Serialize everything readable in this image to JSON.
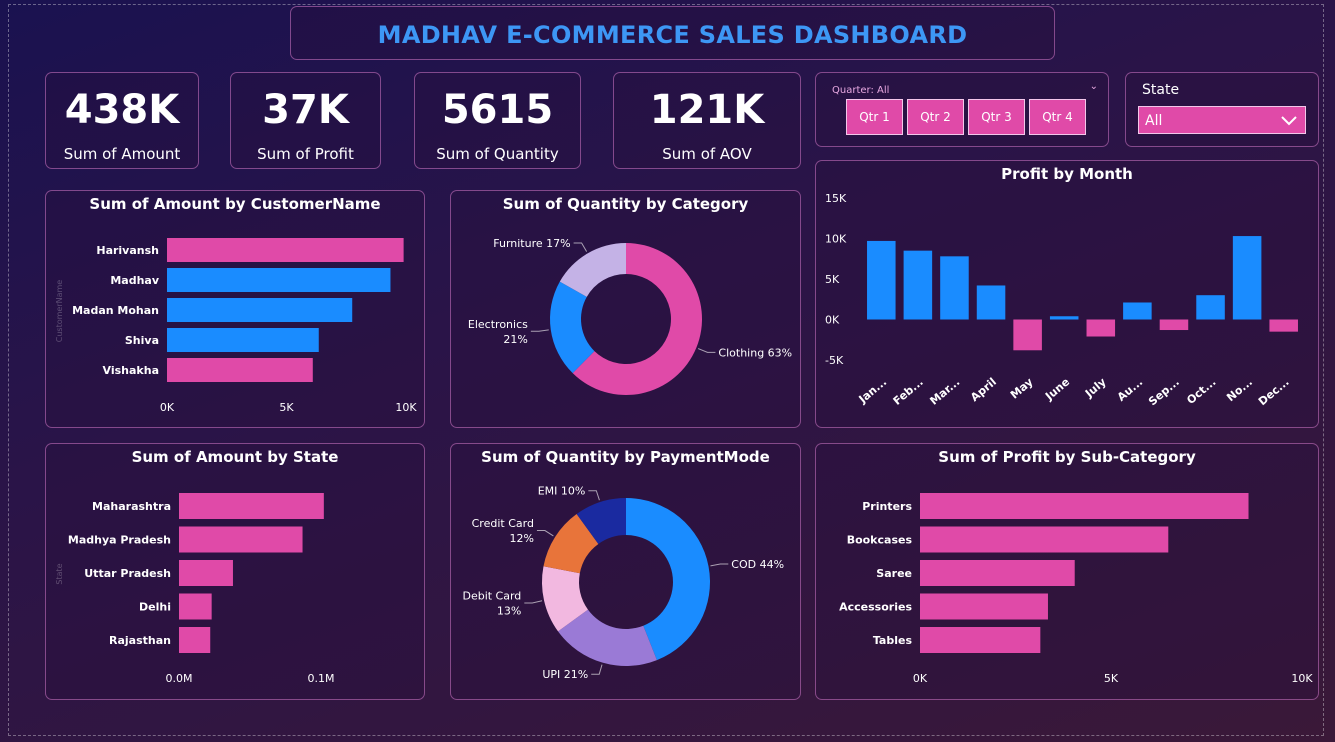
{
  "title": "MADHAV E-COMMERCE SALES DASHBOARD",
  "kpis": [
    {
      "value": "438K",
      "label": "Sum of Amount"
    },
    {
      "value": "37K",
      "label": "Sum of Profit"
    },
    {
      "value": "5615",
      "label": "Sum of Quantity"
    },
    {
      "value": "121K",
      "label": "Sum of AOV"
    }
  ],
  "quarter_slicer": {
    "title": "Quarter: All",
    "options": [
      "Qtr 1",
      "Qtr 2",
      "Qtr 3",
      "Qtr 4"
    ]
  },
  "state_slicer": {
    "label": "State",
    "selected": "All"
  },
  "colors": {
    "pink": "#e04aa8",
    "blue": "#1a8cff",
    "title_blue": "#3d97f5"
  },
  "chart_data": [
    {
      "id": "amount_by_customer",
      "type": "bar",
      "orientation": "horizontal",
      "title": "Sum of Amount by CustomerName",
      "ylabel": "CustomerName",
      "categories": [
        "Harivansh",
        "Madhav",
        "Madan Mohan",
        "Shiva",
        "Vishakha"
      ],
      "values": [
        9900,
        9350,
        7750,
        6350,
        6100
      ],
      "bar_colors": [
        "#e04aa8",
        "#1a8cff",
        "#1a8cff",
        "#1a8cff",
        "#e04aa8"
      ],
      "xlim": [
        0,
        10000
      ],
      "ticks": [
        0,
        5000,
        10000
      ],
      "tick_labels": [
        "0K",
        "5K",
        "10K"
      ]
    },
    {
      "id": "quantity_by_category",
      "type": "pie",
      "donut": true,
      "title": "Sum of Quantity by Category",
      "slices": [
        {
          "label": "Clothing",
          "pct_label": "Clothing 63%",
          "value": 63,
          "color": "#e04aa8"
        },
        {
          "label": "Electronics",
          "pct_label": "Electronics\n21%",
          "value": 21,
          "color": "#1a8cff"
        },
        {
          "label": "Furniture",
          "pct_label": "Furniture 17%",
          "value": 17,
          "color": "#c4b2e6"
        }
      ]
    },
    {
      "id": "profit_by_month",
      "type": "bar",
      "title": "Profit by Month",
      "categories": [
        "Jan...",
        "Feb...",
        "Mar...",
        "April",
        "May",
        "June",
        "July",
        "Au...",
        "Sep...",
        "Oct...",
        "No...",
        "Dec..."
      ],
      "values": [
        9700,
        8500,
        7800,
        4200,
        -3800,
        400,
        -2100,
        2100,
        -1300,
        3000,
        10300,
        -1500
      ],
      "ylim": [
        -5000,
        15000
      ],
      "ticks": [
        -5000,
        0,
        5000,
        10000,
        15000
      ],
      "tick_labels": [
        "-5K",
        "0K",
        "5K",
        "10K",
        "15K"
      ],
      "bar_color": "#1a8cff",
      "negative_color": "#e04aa8"
    },
    {
      "id": "amount_by_state",
      "type": "bar",
      "orientation": "horizontal",
      "title": "Sum of Amount by State",
      "ylabel": "State",
      "categories": [
        "Maharashtra",
        "Madhya Pradesh",
        "Uttar Pradesh",
        "Delhi",
        "Rajasthan"
      ],
      "values": [
        102000,
        87000,
        38000,
        23000,
        22000
      ],
      "xlim": [
        0,
        200000
      ],
      "ticks": [
        0,
        100000
      ],
      "tick_labels": [
        "0.0M",
        "0.1M"
      ],
      "bar_color": "#e04aa8"
    },
    {
      "id": "quantity_by_payment",
      "type": "pie",
      "donut": true,
      "title": "Sum of Quantity by PaymentMode",
      "slices": [
        {
          "label": "COD",
          "pct_label": "COD 44%",
          "value": 44,
          "color": "#1a8cff"
        },
        {
          "label": "UPI",
          "pct_label": "UPI 21%",
          "value": 21,
          "color": "#9a7ad6"
        },
        {
          "label": "Debit Card",
          "pct_label": "Debit Card\n13%",
          "value": 13,
          "color": "#f2b8e0"
        },
        {
          "label": "Credit Card",
          "pct_label": "Credit Card\n12%",
          "value": 12,
          "color": "#e8743a"
        },
        {
          "label": "EMI",
          "pct_label": "EMI 10%",
          "value": 10,
          "color": "#1a2aa0"
        }
      ]
    },
    {
      "id": "profit_by_subcategory",
      "type": "bar",
      "orientation": "horizontal",
      "title": "Sum of Profit by Sub-Category",
      "categories": [
        "Printers",
        "Bookcases",
        "Saree",
        "Accessories",
        "Tables"
      ],
      "values": [
        8600,
        6500,
        4050,
        3350,
        3150
      ],
      "xlim": [
        0,
        10000
      ],
      "ticks": [
        0,
        5000,
        10000
      ],
      "tick_labels": [
        "0K",
        "5K",
        "10K"
      ],
      "bar_color": "#e04aa8"
    }
  ]
}
